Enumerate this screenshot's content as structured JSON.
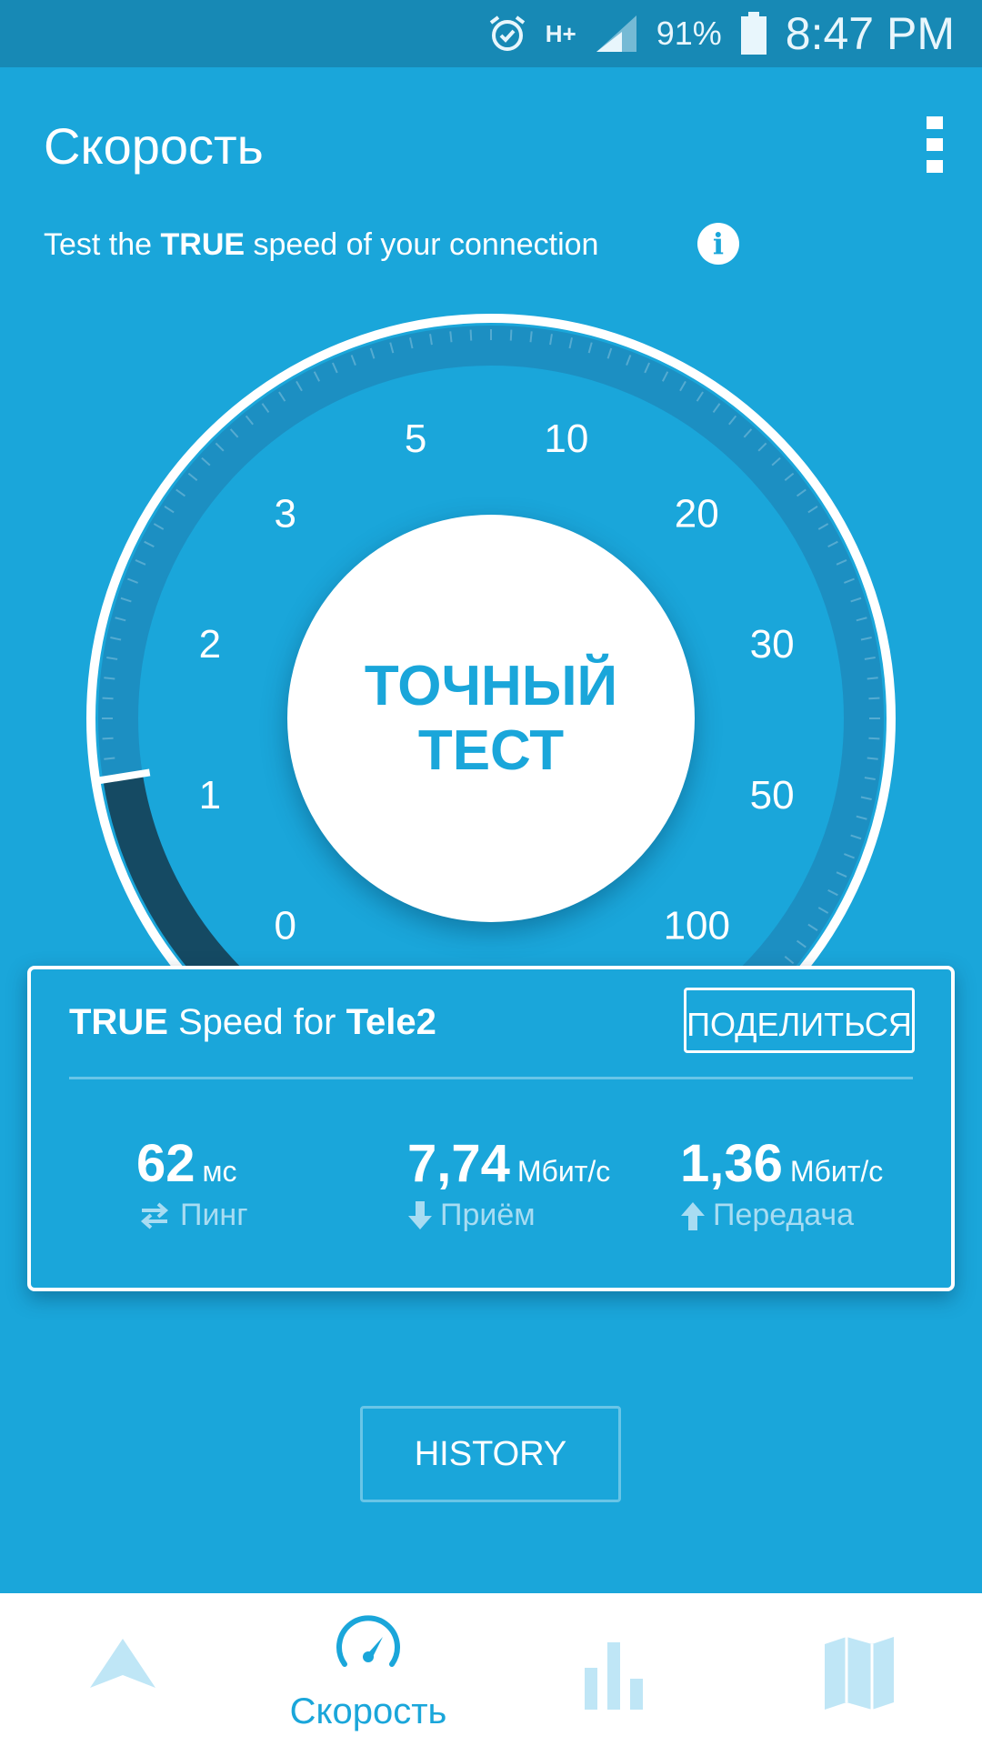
{
  "status_bar": {
    "network": "H+",
    "battery": "91%",
    "time": "8:47 PM"
  },
  "header": {
    "title": "Скорость"
  },
  "subtitle": {
    "before": "Test the ",
    "bold": "TRUE",
    "after": " speed of your connection"
  },
  "gauge": {
    "scale_labels": [
      "0",
      "1",
      "2",
      "3",
      "5",
      "10",
      "20",
      "30",
      "50",
      "100"
    ],
    "start_label": "ТОЧНЫЙ ТЕСТ",
    "needle_value": 1.2
  },
  "result_card": {
    "title_bold_1": "TRUE",
    "title_mid": " Speed for ",
    "title_bold_2": "Tele2",
    "share_label": "ПОДЕЛИТЬСЯ",
    "metrics": [
      {
        "value": "62",
        "unit": "мс",
        "label": "Пинг",
        "icon": "ping-arrows-icon"
      },
      {
        "value": "7,74",
        "unit": "Мбит/с",
        "label": "Приём",
        "icon": "download-arrow-icon"
      },
      {
        "value": "1,36",
        "unit": "Мбит/с",
        "label": "Передача",
        "icon": "upload-arrow-icon"
      }
    ]
  },
  "history": {
    "label": "HISTORY"
  },
  "bottom_nav": {
    "items": [
      {
        "icon": "navigation-arrow-icon",
        "label": ""
      },
      {
        "icon": "speedometer-icon",
        "label": "Скорость"
      },
      {
        "icon": "bar-chart-icon",
        "label": ""
      },
      {
        "icon": "map-icon",
        "label": ""
      }
    ]
  },
  "colors": {
    "background": "#1aa6da",
    "status_bar": "#1789b5",
    "dial_track": "#1c8fc2",
    "dial_progress": "#154a63",
    "nav_inactive": "#bfe6f6"
  }
}
